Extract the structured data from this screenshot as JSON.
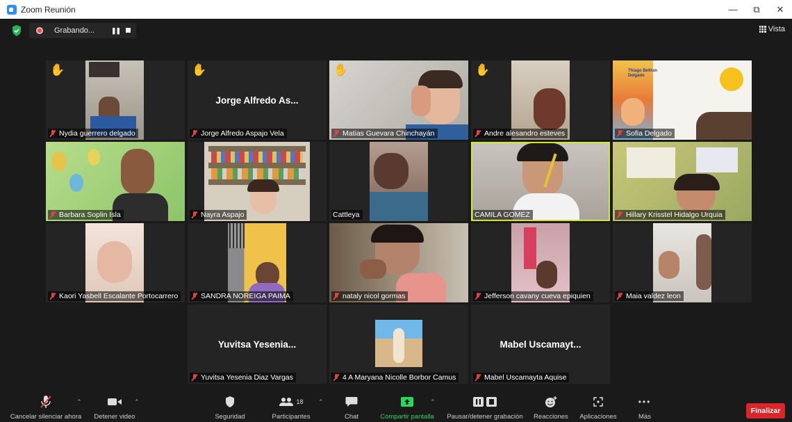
{
  "window": {
    "title": "Zoom Reunión",
    "min_glyph": "—",
    "max_glyph": "⧉",
    "close_glyph": "✕"
  },
  "topbar": {
    "recording_label": "Grabando...",
    "view_label": "Vista"
  },
  "tiles": [
    {
      "name": "Nydia guerrero delgado",
      "muted": true,
      "hand": true
    },
    {
      "name": "Jorge Alfredo Aspajo Vela",
      "display_name": "Jorge Alfredo As...",
      "muted": true,
      "hand": true
    },
    {
      "name": "Matias Guevara Chinchayán",
      "muted": true,
      "hand": true
    },
    {
      "name": "Andre alesandro esteves",
      "muted": true,
      "hand": true
    },
    {
      "name": "Sofia Delgado",
      "muted": true,
      "hand": false
    },
    {
      "name": "Barbara Soplin Isla",
      "muted": true,
      "hand": false
    },
    {
      "name": "Nayra Aspajo",
      "muted": true,
      "hand": false
    },
    {
      "name": "Cattleya",
      "muted": false,
      "hand": false
    },
    {
      "name": "CAMILA GOMEZ",
      "muted": false,
      "hand": false,
      "active": true
    },
    {
      "name": "Hillary Krisstel Hidalgo Urquia",
      "muted": true,
      "hand": false
    },
    {
      "name": "Kaori Yasbell Escalante Portocarrero",
      "muted": true,
      "hand": false
    },
    {
      "name": "SANDRA NOREIGA PAIMA",
      "muted": true,
      "hand": false
    },
    {
      "name": "nataly nicol gormas",
      "muted": true,
      "hand": false
    },
    {
      "name": "Jefferson cavany cueva epiquien",
      "muted": true,
      "hand": false
    },
    {
      "name": "Maia valdez leon",
      "muted": true,
      "hand": false
    },
    {
      "name": "Yuvitsa Yesenia Diaz Vargas",
      "display_name": "Yuvitsa Yesenia...",
      "muted": true,
      "hand": false
    },
    {
      "name": "4 A Maryana Nicolle Borbor Camus",
      "muted": true,
      "hand": false
    },
    {
      "name": "Mabel Uscamayta Aquise",
      "display_name": "Mabel Uscamayt...",
      "muted": true,
      "hand": false
    }
  ],
  "sofia_card_text": "Thiago Beltran Delgado",
  "toolbar": {
    "unmute": "Cancelar silenciar ahora",
    "video": "Detener video",
    "security": "Seguridad",
    "participants": "Participantes",
    "participants_count": "18",
    "chat": "Chat",
    "share": "Compartir pantalla",
    "recording": "Pausar/detener grabación",
    "reactions": "Reacciones",
    "apps": "Aplicaciones",
    "more": "Más",
    "end": "Finalizar"
  },
  "colors": {
    "accent_green": "#23d959",
    "end_red": "#d9262a",
    "hand_yellow": "#f5b800",
    "active_border": "#d0e830"
  },
  "icons": [
    "zoom-app-icon",
    "shield-icon",
    "record-icon",
    "grid-icon",
    "raised-hand-icon",
    "muted-mic-icon",
    "microphone-icon",
    "video-icon",
    "participants-icon",
    "chat-icon",
    "share-screen-icon",
    "pause-stop-icon",
    "reaction-icon",
    "apps-icon",
    "more-icon"
  ]
}
